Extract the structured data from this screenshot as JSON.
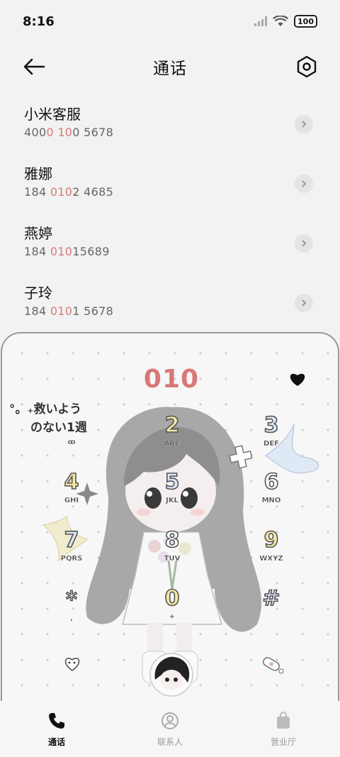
{
  "status_bar": {
    "time": "8:16",
    "battery": "100"
  },
  "header": {
    "title": "通话"
  },
  "contacts": [
    {
      "name": "小米客服",
      "number_parts": [
        "400",
        "0 10",
        "0 5678"
      ]
    },
    {
      "name": "雅娜",
      "number_parts": [
        "184 ",
        "010",
        "2 4685"
      ]
    },
    {
      "name": "燕婷",
      "number_parts": [
        "184 ",
        "010",
        "15689"
      ]
    },
    {
      "name": "子玲",
      "number_parts": [
        "184 ",
        "010",
        "1 5678"
      ]
    }
  ],
  "dialpad": {
    "digits": "010",
    "decor_text": [
      "°。₊救いよう",
      "のない1週"
    ],
    "decor_small": "ꝏ",
    "keys": [
      {
        "num": "1",
        "letters": "ꝏ"
      },
      {
        "num": "2",
        "letters": "ABC"
      },
      {
        "num": "3",
        "letters": "DEF"
      },
      {
        "num": "4",
        "letters": "GHI"
      },
      {
        "num": "5",
        "letters": "JKL"
      },
      {
        "num": "6",
        "letters": "MNO"
      },
      {
        "num": "7",
        "letters": "PQRS"
      },
      {
        "num": "8",
        "letters": "TUV"
      },
      {
        "num": "9",
        "letters": "WXYZ"
      },
      {
        "num": "*",
        "letters": ","
      },
      {
        "num": "0",
        "letters": "+"
      },
      {
        "num": "#",
        "letters": ""
      }
    ]
  },
  "nav": {
    "items": [
      {
        "label": "通话",
        "icon": "phone-icon",
        "active": true
      },
      {
        "label": "联系人",
        "icon": "contacts-icon",
        "active": false
      },
      {
        "label": "营业厅",
        "icon": "bag-icon",
        "active": false
      }
    ]
  },
  "colors": {
    "highlight": "#d97a7a",
    "accent_digits": "#d9787a"
  }
}
